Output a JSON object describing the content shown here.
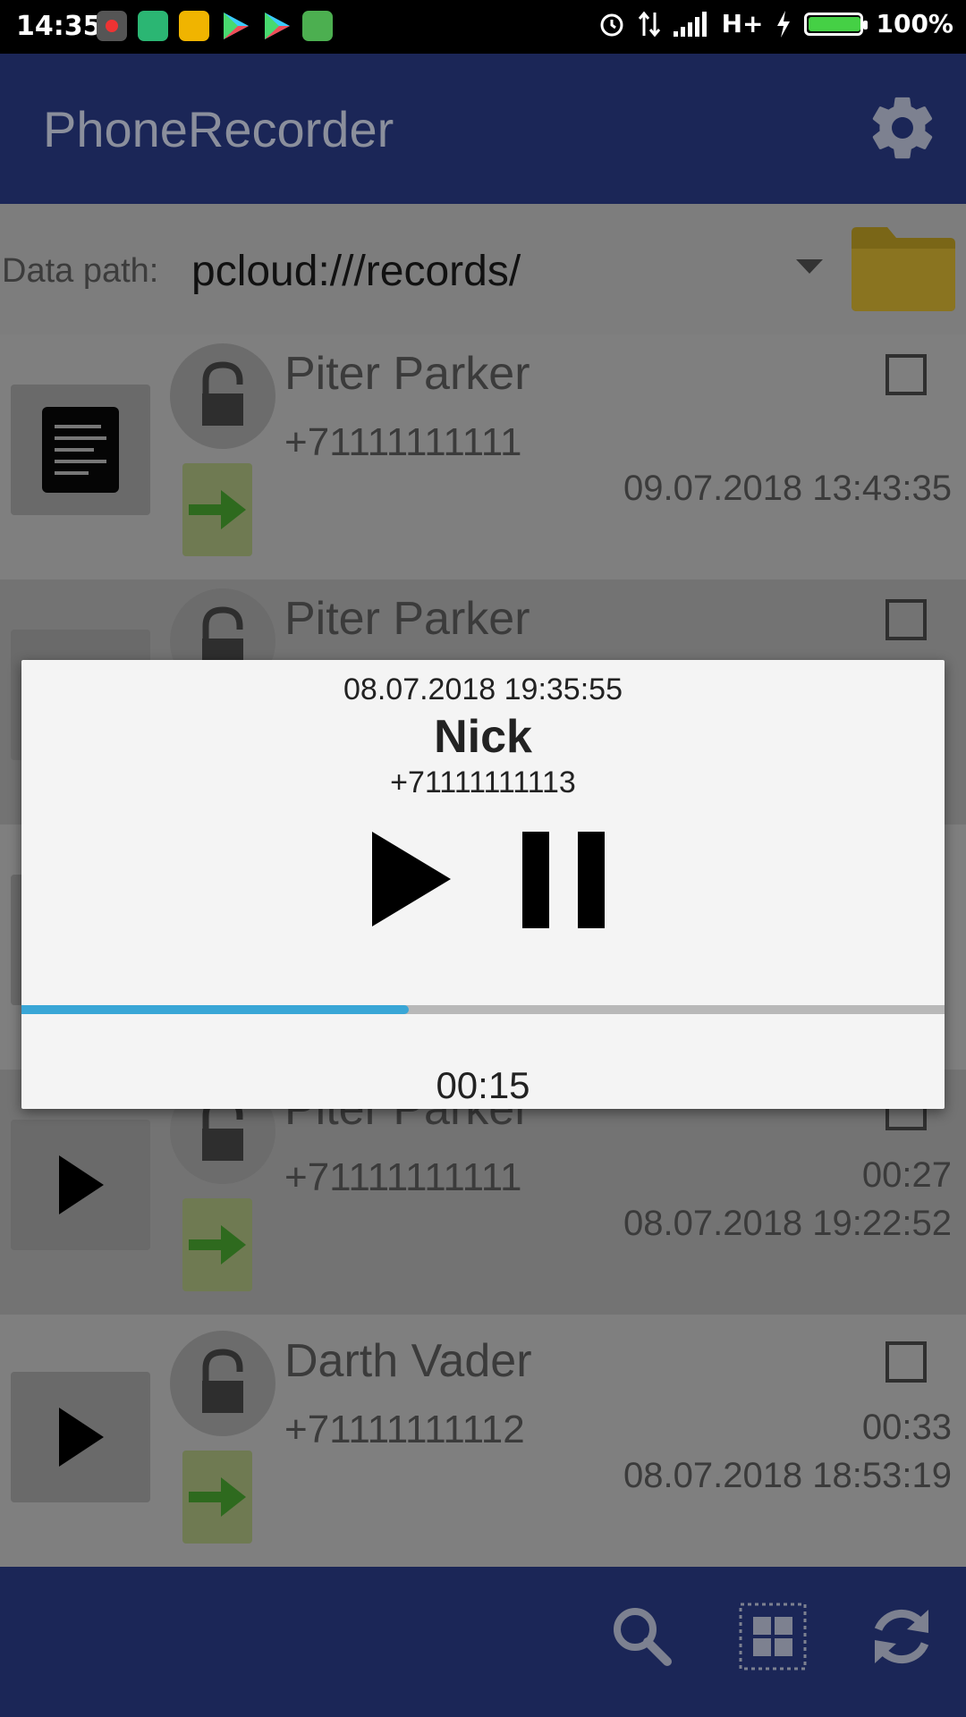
{
  "status_bar": {
    "time": "14:35",
    "network": "H+",
    "battery": "100%",
    "battery_level": 1.0,
    "icons": [
      "record-icon",
      "shield-app-icon",
      "photo-app-icon",
      "play-store-icon",
      "play-store-icon",
      "android-icon",
      "alarm-icon",
      "data-transfer-icon",
      "signal-icon",
      "charging-icon"
    ]
  },
  "app_bar": {
    "title": "PhoneRecorder",
    "settings_icon": "gear-icon"
  },
  "path_row": {
    "label": "Data path:",
    "value": "pcloud:///records/",
    "folder_icon": "folder-icon"
  },
  "records": [
    {
      "name": "Piter Parker",
      "phone": "+71111111111",
      "duration": "",
      "date": "09.07.2018 13:43:35",
      "thumb": "document-icon",
      "direction": "outgoing-arrow-icon",
      "checked": false
    },
    {
      "name": "Piter Parker",
      "phone": "",
      "duration": "",
      "date": "",
      "thumb": "play-icon",
      "direction": "outgoing-arrow-icon",
      "checked": false
    },
    {
      "name": "Piter Parker",
      "phone": "+71111111111",
      "duration": "00:27",
      "date": "08.07.2018 19:22:52",
      "thumb": "play-icon",
      "direction": "outgoing-arrow-icon",
      "checked": false
    },
    {
      "name": "Darth Vader",
      "phone": "+71111111112",
      "duration": "00:33",
      "date": "08.07.2018 18:53:19",
      "thumb": "play-icon",
      "direction": "outgoing-arrow-icon",
      "checked": false
    }
  ],
  "bottom_bar": {
    "icons": [
      "search-icon",
      "grid-select-icon",
      "refresh-icon"
    ]
  },
  "player_dialog": {
    "date": "08.07.2018 19:35:55",
    "name": "Nick",
    "phone": "+71111111113",
    "elapsed": "00:15",
    "progress": 0.42,
    "colors": {
      "progress": "#39a6d6",
      "track": "#b8b8b8"
    }
  }
}
